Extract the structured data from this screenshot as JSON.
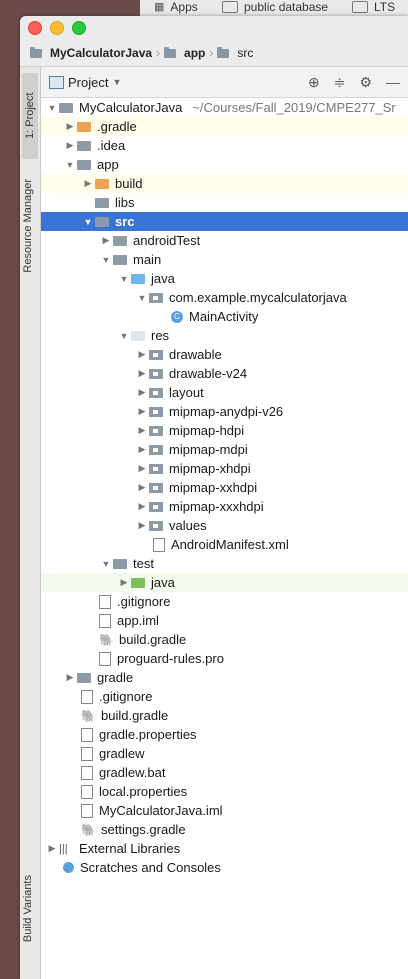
{
  "bookmarks": {
    "apps": "Apps",
    "public_db": "public database",
    "lts": "LTS"
  },
  "breadcrumb": {
    "project": "MyCalculatorJava",
    "module": "app",
    "folder": "src"
  },
  "panel": {
    "selector": "Project"
  },
  "sidebar": {
    "project_tab": "1: Project",
    "resource_tab": "Resource Manager",
    "build_variants_tab": "Build Variants"
  },
  "tree": {
    "root": "MyCalculatorJava",
    "root_path": "~/Courses/Fall_2019/CMPE277_Sr",
    "r1": ".gradle",
    "r2": ".idea",
    "r3": "app",
    "r4": "build",
    "r5": "libs",
    "r6": "src",
    "r7": "androidTest",
    "r8": "main",
    "r9": "java",
    "r10": "com.example.mycalculatorjava",
    "r11": "MainActivity",
    "r12": "res",
    "r13": "drawable",
    "r14": "drawable-v24",
    "r15": "layout",
    "r16": "mipmap-anydpi-v26",
    "r17": "mipmap-hdpi",
    "r18": "mipmap-mdpi",
    "r19": "mipmap-xhdpi",
    "r20": "mipmap-xxhdpi",
    "r21": "mipmap-xxxhdpi",
    "r22": "values",
    "r23": "AndroidManifest.xml",
    "r24": "test",
    "r25": "java",
    "r26": ".gitignore",
    "r27": "app.iml",
    "r28": "build.gradle",
    "r29": "proguard-rules.pro",
    "r30": "gradle",
    "r31": ".gitignore",
    "r32": "build.gradle",
    "r33": "gradle.properties",
    "r34": "gradlew",
    "r35": "gradlew.bat",
    "r36": "local.properties",
    "r37": "MyCalculatorJava.iml",
    "r38": "settings.gradle",
    "r39": "External Libraries",
    "r40": "Scratches and Consoles"
  }
}
